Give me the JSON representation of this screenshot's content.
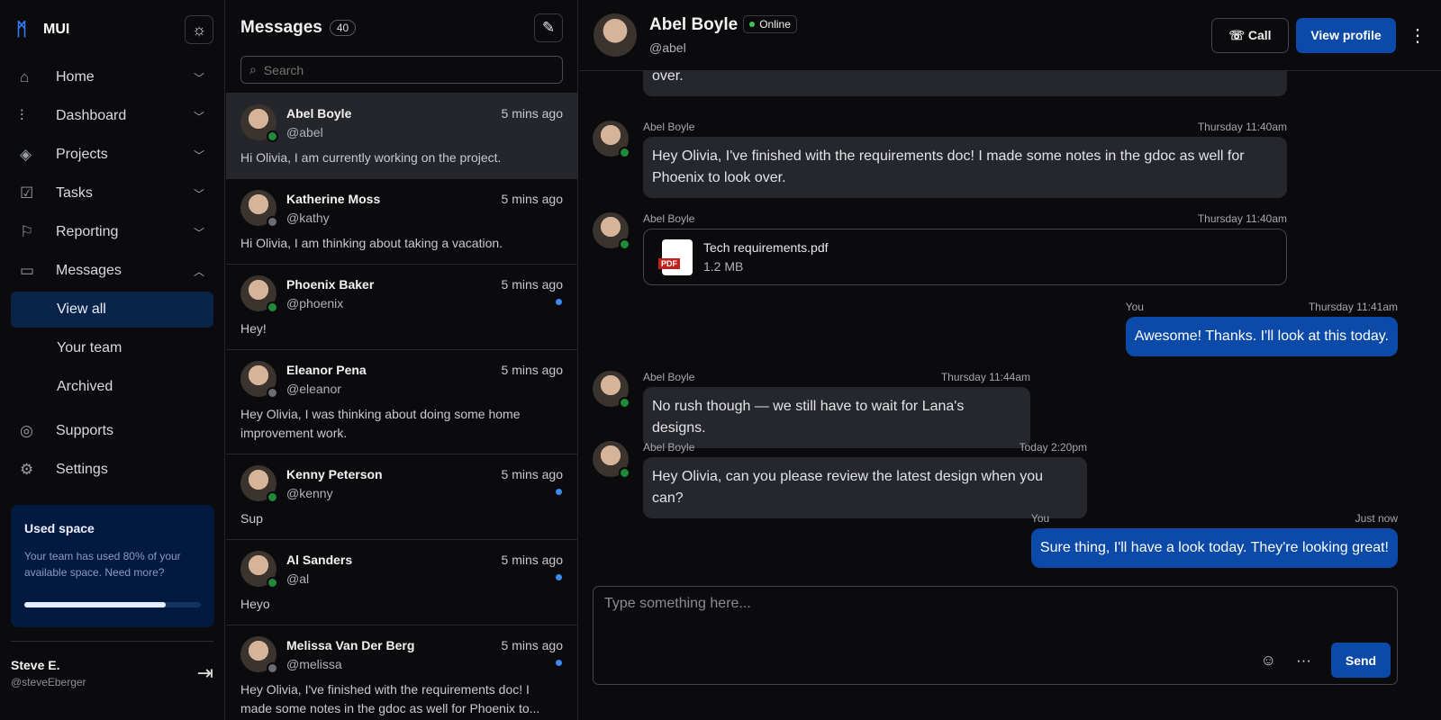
{
  "sidebar": {
    "brand": "MUI",
    "items": [
      {
        "label": "Home",
        "icon": "home-icon"
      },
      {
        "label": "Dashboard",
        "icon": "bar-chart-icon"
      },
      {
        "label": "Projects",
        "icon": "layers-icon"
      },
      {
        "label": "Tasks",
        "icon": "check-square-icon"
      },
      {
        "label": "Reporting",
        "icon": "flag-icon"
      },
      {
        "label": "Messages",
        "icon": "message-icon"
      }
    ],
    "sub_items": [
      "View all",
      "Your team",
      "Archived"
    ],
    "bottom_items": [
      {
        "label": "Supports",
        "icon": "lifebuoy-icon"
      },
      {
        "label": "Settings",
        "icon": "gear-icon"
      }
    ],
    "used_space": {
      "title": "Used space",
      "text": "Your team has used 80% of your available space. Need more?",
      "percent": 80
    },
    "user": {
      "name": "Steve E.",
      "handle": "@steveEberger"
    }
  },
  "list": {
    "title": "Messages",
    "count": "40",
    "search_placeholder": "Search",
    "conversations": [
      {
        "name": "Abel Boyle",
        "handle": "@abel",
        "time": "5 mins ago",
        "message": "Hi Olivia, I am currently working on the project.",
        "online": true,
        "unread": false
      },
      {
        "name": "Katherine Moss",
        "handle": "@kathy",
        "time": "5 mins ago",
        "message": "Hi Olivia, I am thinking about taking a vacation.",
        "online": false,
        "unread": false
      },
      {
        "name": "Phoenix Baker",
        "handle": "@phoenix",
        "time": "5 mins ago",
        "message": "Hey!",
        "online": true,
        "unread": true
      },
      {
        "name": "Eleanor Pena",
        "handle": "@eleanor",
        "time": "5 mins ago",
        "message": "Hey Olivia, I was thinking about doing some home improvement work.",
        "online": false,
        "unread": false
      },
      {
        "name": "Kenny Peterson",
        "handle": "@kenny",
        "time": "5 mins ago",
        "message": "Sup",
        "online": true,
        "unread": true
      },
      {
        "name": "Al Sanders",
        "handle": "@al",
        "time": "5 mins ago",
        "message": "Heyo",
        "online": true,
        "unread": true
      },
      {
        "name": "Melissa Van Der Berg",
        "handle": "@melissa",
        "time": "5 mins ago",
        "message": "Hey Olivia, I've finished with the requirements doc! I made some notes in the gdoc as well for Phoenix to...",
        "online": false,
        "unread": true
      }
    ]
  },
  "chat": {
    "name": "Abel Boyle",
    "status": "Online",
    "handle": "@abel",
    "call": "Call",
    "view_profile": "View profile",
    "messages": [
      {
        "sender": "",
        "time": "",
        "text": "over."
      },
      {
        "sender": "Abel Boyle",
        "time": "Thursday 11:40am",
        "text": "Hey Olivia, I've finished with the requirements doc! I made some notes in the gdoc as well for Phoenix to look over."
      },
      {
        "sender": "Abel Boyle",
        "time": "Thursday 11:40am",
        "file": {
          "name": "Tech requirements.pdf",
          "size": "1.2 MB",
          "badge": "PDF"
        }
      },
      {
        "sender": "You",
        "time": "Thursday 11:41am",
        "text": "Awesome! Thanks. I'll look at this today."
      },
      {
        "sender": "Abel Boyle",
        "time": "Thursday 11:44am",
        "text": "No rush though — we still have to wait for Lana's designs."
      },
      {
        "sender": "Abel Boyle",
        "time": "Today 2:20pm",
        "text": "Hey Olivia, can you please review the latest design when you can?"
      },
      {
        "sender": "You",
        "time": "Just now",
        "text": "Sure thing, I'll have a look today. They're looking great!"
      }
    ],
    "composer": {
      "placeholder": "Type something here...",
      "send": "Send"
    }
  },
  "colors": {
    "accent": "#0b4aa8",
    "online": "#1f8a3a",
    "offline": "#6b6d75",
    "unread": "#3b8bf5"
  }
}
